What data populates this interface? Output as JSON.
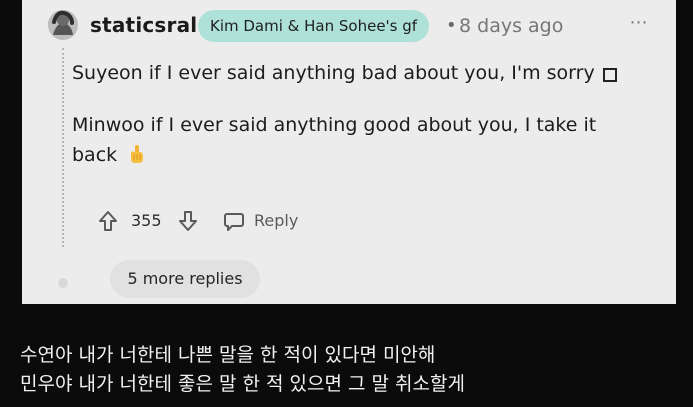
{
  "comment": {
    "username": "staticsral",
    "flair": "Kim Dami & Han Sohee's gf",
    "separator": "•",
    "timestamp": "8 days ago",
    "menu_icon": "more-options-icon",
    "paragraphs": [
      {
        "text": "Suyeon if I ever said anything bad about you, I'm sorry",
        "icon": "empty-box-icon"
      },
      {
        "text": "Minwoo if I ever said anything good about you, I take it back",
        "icon": "middle-finger-emoji-icon"
      }
    ],
    "vote_score": "355",
    "reply_label": "Reply",
    "more_replies_label": "5 more replies"
  },
  "caption": {
    "line1": "수연아 내가 너한테 나쁜 말을 한 적이 있다면 미안해",
    "line2": "민우야 내가 너한테 좋은 말 한 적 있으면 그 말 취소할게"
  },
  "colors": {
    "page_background": "#0b0b0b",
    "card_background": "#ececec",
    "flair_background": "#aee2d8",
    "text_primary": "#1c1c1c",
    "text_meta": "#767676",
    "caption_text": "#f1f1f1"
  }
}
